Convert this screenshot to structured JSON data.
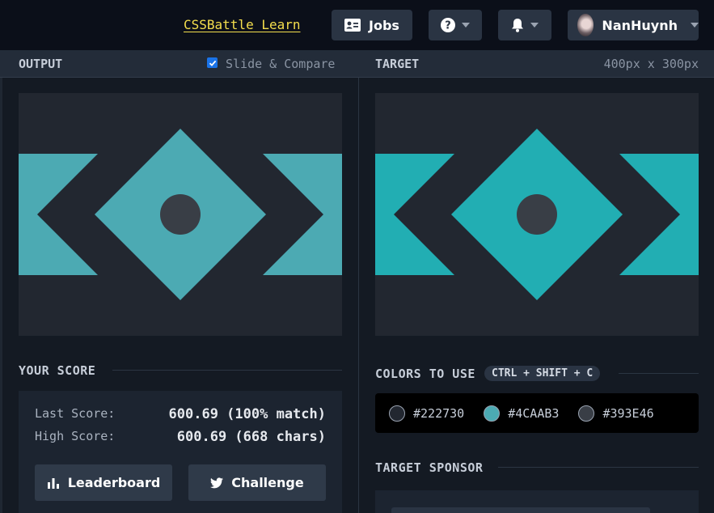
{
  "nav": {
    "learn_link": "CSSBattle Learn",
    "jobs_label": "Jobs",
    "username": "NanHuynh",
    "icons": {
      "jobs": "id-card-icon",
      "help": "question-icon",
      "bell": "bell-icon",
      "caret": "chevron-down-icon"
    }
  },
  "output": {
    "title": "OUTPUT",
    "compare_label": "Slide & Compare",
    "compare_checked": true
  },
  "target": {
    "title": "TARGET",
    "dimensions": "400px x 300px"
  },
  "art": {
    "background": "#222730",
    "shape": "#4CAAB3",
    "dot": "#393E46",
    "target_shape": "#22aeb3"
  },
  "score": {
    "title": "YOUR SCORE",
    "last_label": "Last Score:",
    "last_value": "600.69 (100% match)",
    "high_label": "High Score:",
    "high_value": "600.69 (668 chars)",
    "leaderboard_label": "Leaderboard",
    "challenge_label": "Challenge"
  },
  "colors": {
    "title": "COLORS TO USE",
    "shortcut": "CTRL + SHIFT + C",
    "list": [
      {
        "hex": "#222730",
        "label": "#222730"
      },
      {
        "hex": "#4CAAB3",
        "label": "#4CAAB3"
      },
      {
        "hex": "#393E46",
        "label": "#393E46"
      }
    ]
  },
  "sponsor": {
    "title": "TARGET SPONSOR"
  }
}
